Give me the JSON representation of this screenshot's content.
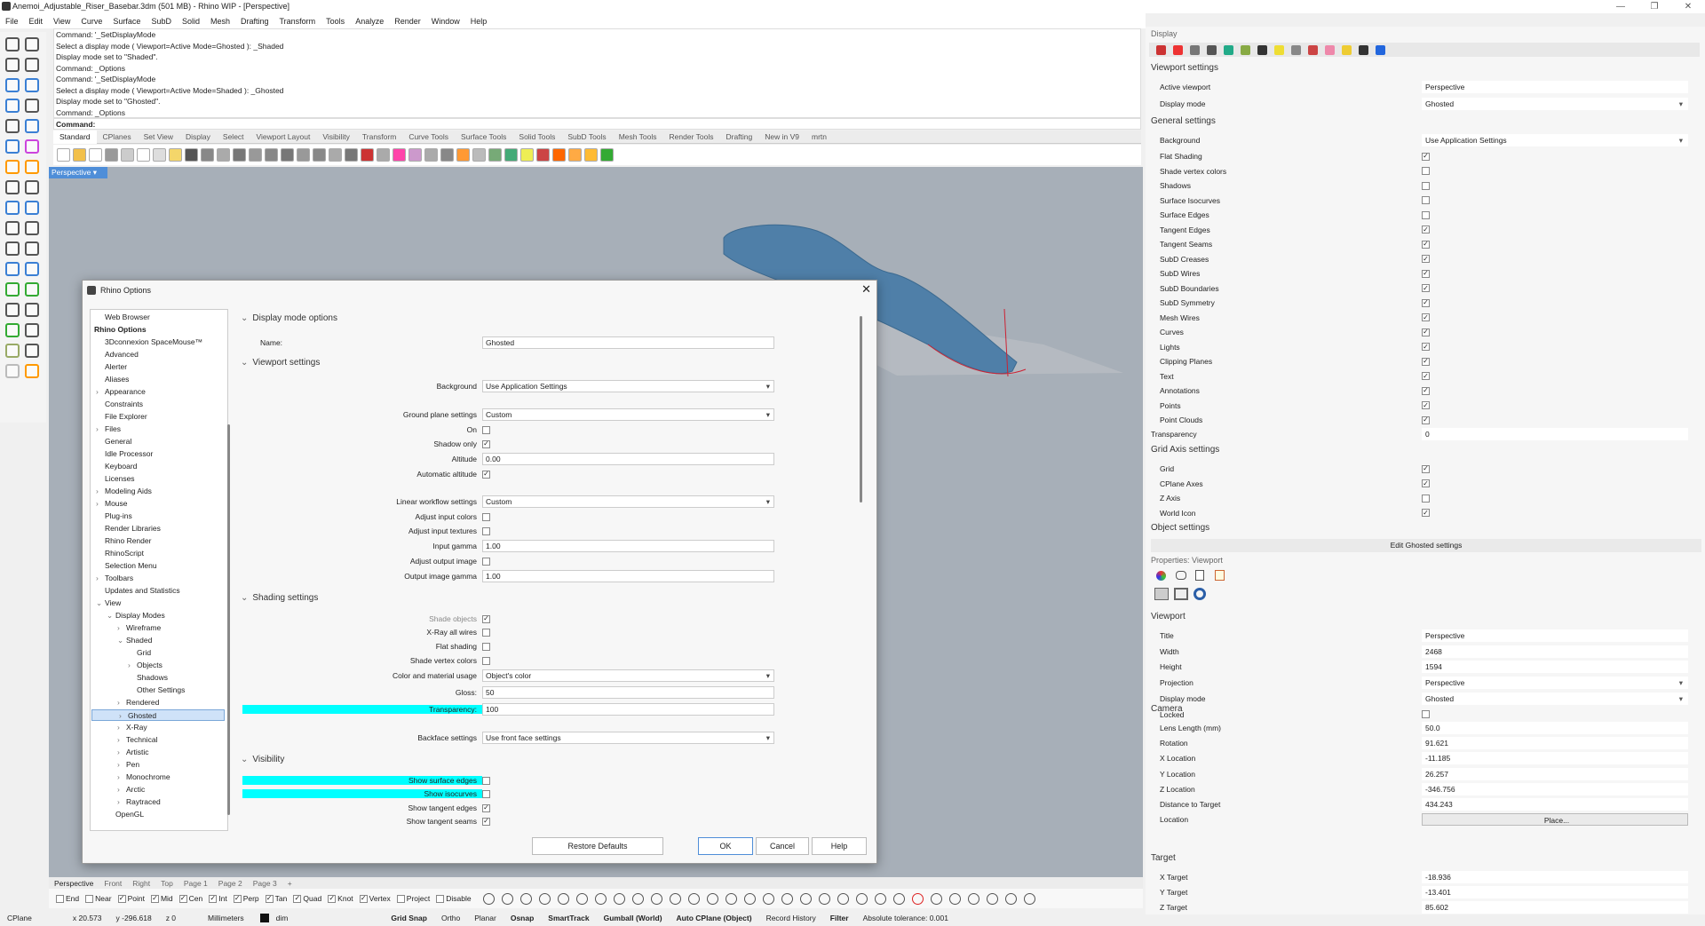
{
  "window": {
    "title": "Anemoi_Adjustable_Riser_Basebar.3dm (501 MB) - Rhino WIP - [Perspective]"
  },
  "menu": [
    "File",
    "Edit",
    "View",
    "Curve",
    "Surface",
    "SubD",
    "Solid",
    "Mesh",
    "Drafting",
    "Transform",
    "Tools",
    "Analyze",
    "Render",
    "Window",
    "Help"
  ],
  "command_history": [
    "Command: '_SetDisplayMode",
    "Select a display mode ( Viewport=Active  Mode=Ghosted ): _Shaded",
    "Display mode set to \"Shaded\".",
    "Command: _Options",
    "Command: '_SetDisplayMode",
    "Select a display mode ( Viewport=Active  Mode=Shaded ): _Ghosted",
    "Display mode set to \"Ghosted\".",
    "Command: _Options"
  ],
  "command_prompt": "Command:",
  "toolbar_tabs": [
    "Standard",
    "CPlanes",
    "Set View",
    "Display",
    "Select",
    "Viewport Layout",
    "Visibility",
    "Transform",
    "Curve Tools",
    "Surface Tools",
    "Solid Tools",
    "SubD Tools",
    "Mesh Tools",
    "Render Tools",
    "Drafting",
    "New in V9",
    "mrtn"
  ],
  "viewport_label": "Perspective",
  "viewport_tabs": [
    "Perspective",
    "Front",
    "Right",
    "Top",
    "Page 1",
    "Page 2",
    "Page 3"
  ],
  "osnaps": [
    {
      "label": "End",
      "checked": false
    },
    {
      "label": "Near",
      "checked": false
    },
    {
      "label": "Point",
      "checked": true
    },
    {
      "label": "Mid",
      "checked": true
    },
    {
      "label": "Cen",
      "checked": true
    },
    {
      "label": "Int",
      "checked": true
    },
    {
      "label": "Perp",
      "checked": true
    },
    {
      "label": "Tan",
      "checked": true
    },
    {
      "label": "Quad",
      "checked": true
    },
    {
      "label": "Knot",
      "checked": true
    },
    {
      "label": "Vertex",
      "checked": true
    },
    {
      "label": "Project",
      "checked": false
    },
    {
      "label": "Disable",
      "checked": false
    }
  ],
  "status": {
    "cplane": "CPlane",
    "x": "x 20.573",
    "y": "y -296.618",
    "z": "z 0",
    "units": "Millimeters",
    "layer": "dim",
    "items": [
      "Grid Snap",
      "Ortho",
      "Planar",
      "Osnap",
      "SmartTrack",
      "Gumball (World)",
      "Auto CPlane (Object)",
      "Record History",
      "Filter"
    ],
    "bold_items": [
      "Grid Snap",
      "Osnap",
      "SmartTrack",
      "Gumball (World)",
      "Auto CPlane (Object)",
      "Filter"
    ],
    "tolerance": "Absolute tolerance: 0.001"
  },
  "display_panel": {
    "title": "Display",
    "viewport_settings_head": "Viewport settings",
    "active_viewport_label": "Active viewport",
    "active_viewport": "Perspective",
    "display_mode_label": "Display mode",
    "display_mode": "Ghosted",
    "general_head": "General settings",
    "background_label": "Background",
    "background": "Use Application Settings",
    "checks": [
      {
        "label": "Flat Shading",
        "checked": true
      },
      {
        "label": "Shade vertex colors",
        "checked": false
      },
      {
        "label": "Shadows",
        "checked": false
      },
      {
        "label": "Surface Isocurves",
        "checked": false
      },
      {
        "label": "Surface Edges",
        "checked": false
      },
      {
        "label": "Tangent Edges",
        "checked": true
      },
      {
        "label": "Tangent Seams",
        "checked": true
      },
      {
        "label": "SubD Creases",
        "checked": true
      },
      {
        "label": "SubD Wires",
        "checked": true
      },
      {
        "label": "SubD Boundaries",
        "checked": true
      },
      {
        "label": "SubD Symmetry",
        "checked": true
      },
      {
        "label": "Mesh Wires",
        "checked": true
      },
      {
        "label": "Curves",
        "checked": true
      },
      {
        "label": "Lights",
        "checked": true
      },
      {
        "label": "Clipping Planes",
        "checked": true
      },
      {
        "label": "Text",
        "checked": true
      },
      {
        "label": "Annotations",
        "checked": true
      },
      {
        "label": "Points",
        "checked": true
      },
      {
        "label": "Point Clouds",
        "checked": true
      }
    ],
    "transparency_label": "Transparency",
    "transparency": "0",
    "grid_head": "Grid  Axis settings",
    "grid_checks": [
      {
        "label": "Grid",
        "checked": true
      },
      {
        "label": "CPlane Axes",
        "checked": true
      },
      {
        "label": "Z Axis",
        "checked": false
      },
      {
        "label": "World Icon",
        "checked": true
      }
    ],
    "object_head": "Object settings",
    "edit_button": "Edit Ghosted settings"
  },
  "properties_panel": {
    "title": "Properties: Viewport",
    "viewport_head": "Viewport",
    "viewport_rows": [
      {
        "label": "Title",
        "value": "Perspective",
        "type": "text"
      },
      {
        "label": "Width",
        "value": "2468",
        "type": "spin"
      },
      {
        "label": "Height",
        "value": "1594",
        "type": "spin"
      },
      {
        "label": "Projection",
        "value": "Perspective",
        "type": "dd"
      },
      {
        "label": "Display mode",
        "value": "Ghosted",
        "type": "dd"
      },
      {
        "label": "Locked",
        "value": "",
        "type": "check"
      }
    ],
    "camera_head": "Camera",
    "camera_rows": [
      {
        "label": "Lens Length (mm)",
        "value": "50.0",
        "type": "spin"
      },
      {
        "label": "Rotation",
        "value": "91.621",
        "type": "spin"
      },
      {
        "label": "X Location",
        "value": "-11.185",
        "type": "spin"
      },
      {
        "label": "Y Location",
        "value": "26.257",
        "type": "spin"
      },
      {
        "label": "Z Location",
        "value": "-346.756",
        "type": "spin"
      },
      {
        "label": "Distance to Target",
        "value": "434.243",
        "type": "text"
      },
      {
        "label": "Location",
        "value": "Place...",
        "type": "button"
      }
    ],
    "target_head": "Target",
    "target_rows": [
      {
        "label": "X Target",
        "value": "-18.936",
        "type": "spin"
      },
      {
        "label": "Y Target",
        "value": "-13.401",
        "type": "spin"
      },
      {
        "label": "Z Target",
        "value": "85.602",
        "type": "spin"
      }
    ]
  },
  "dialog": {
    "title": "Rhino Options",
    "tree": [
      {
        "label": "Web Browser",
        "level": 1,
        "arrow": ""
      },
      {
        "label": "Rhino Options",
        "level": 0,
        "arrow": "",
        "bold": true
      },
      {
        "label": "3Dconnexion SpaceMouse™",
        "level": 1,
        "arrow": ""
      },
      {
        "label": "Advanced",
        "level": 1,
        "arrow": ""
      },
      {
        "label": "Alerter",
        "level": 1,
        "arrow": ""
      },
      {
        "label": "Aliases",
        "level": 1,
        "arrow": ""
      },
      {
        "label": "Appearance",
        "level": 1,
        "arrow": "›"
      },
      {
        "label": "Constraints",
        "level": 1,
        "arrow": ""
      },
      {
        "label": "File Explorer",
        "level": 1,
        "arrow": ""
      },
      {
        "label": "Files",
        "level": 1,
        "arrow": "›"
      },
      {
        "label": "General",
        "level": 1,
        "arrow": ""
      },
      {
        "label": "Idle Processor",
        "level": 1,
        "arrow": ""
      },
      {
        "label": "Keyboard",
        "level": 1,
        "arrow": ""
      },
      {
        "label": "Licenses",
        "level": 1,
        "arrow": ""
      },
      {
        "label": "Modeling Aids",
        "level": 1,
        "arrow": "›"
      },
      {
        "label": "Mouse",
        "level": 1,
        "arrow": "›"
      },
      {
        "label": "Plug-ins",
        "level": 1,
        "arrow": ""
      },
      {
        "label": "Render Libraries",
        "level": 1,
        "arrow": ""
      },
      {
        "label": "Rhino Render",
        "level": 1,
        "arrow": ""
      },
      {
        "label": "RhinoScript",
        "level": 1,
        "arrow": ""
      },
      {
        "label": "Selection Menu",
        "level": 1,
        "arrow": ""
      },
      {
        "label": "Toolbars",
        "level": 1,
        "arrow": "›"
      },
      {
        "label": "Updates and Statistics",
        "level": 1,
        "arrow": ""
      },
      {
        "label": "View",
        "level": 1,
        "arrow": "⌄"
      },
      {
        "label": "Display Modes",
        "level": 2,
        "arrow": "⌄"
      },
      {
        "label": "Wireframe",
        "level": 3,
        "arrow": "›"
      },
      {
        "label": "Shaded",
        "level": 3,
        "arrow": "⌄"
      },
      {
        "label": "Grid",
        "level": 4,
        "arrow": ""
      },
      {
        "label": "Objects",
        "level": 4,
        "arrow": "›"
      },
      {
        "label": "Shadows",
        "level": 4,
        "arrow": ""
      },
      {
        "label": "Other Settings",
        "level": 4,
        "arrow": ""
      },
      {
        "label": "Rendered",
        "level": 3,
        "arrow": "›"
      },
      {
        "label": "Ghosted",
        "level": 3,
        "arrow": "›",
        "selected": true
      },
      {
        "label": "X-Ray",
        "level": 3,
        "arrow": "›"
      },
      {
        "label": "Technical",
        "level": 3,
        "arrow": "›"
      },
      {
        "label": "Artistic",
        "level": 3,
        "arrow": "›"
      },
      {
        "label": "Pen",
        "level": 3,
        "arrow": "›"
      },
      {
        "label": "Monochrome",
        "level": 3,
        "arrow": "›"
      },
      {
        "label": "Arctic",
        "level": 3,
        "arrow": "›"
      },
      {
        "label": "Raytraced",
        "level": 3,
        "arrow": "›"
      },
      {
        "label": "OpenGL",
        "level": 2,
        "arrow": ""
      }
    ],
    "sections": {
      "display_mode_options": "Display mode options",
      "viewport_settings": "Viewport settings",
      "shading_settings": "Shading settings",
      "visibility": "Visibility"
    },
    "name_label": "Name:",
    "name_value": "Ghosted",
    "rows": {
      "background": {
        "label": "Background",
        "value": "Use Application Settings"
      },
      "ground_plane": {
        "label": "Ground plane settings",
        "value": "Custom"
      },
      "on": {
        "label": "On",
        "checked": false
      },
      "shadow_only": {
        "label": "Shadow only",
        "checked": true
      },
      "altitude": {
        "label": "Altitude",
        "value": "0.00"
      },
      "auto_altitude": {
        "label": "Automatic altitude",
        "checked": true
      },
      "linear_workflow": {
        "label": "Linear workflow settings",
        "value": "Custom"
      },
      "adjust_input_colors": {
        "label": "Adjust input colors",
        "checked": false
      },
      "adjust_input_textures": {
        "label": "Adjust input textures",
        "checked": false
      },
      "input_gamma": {
        "label": "Input gamma",
        "value": "1.00"
      },
      "adjust_output_image": {
        "label": "Adjust output image",
        "checked": false
      },
      "output_gamma": {
        "label": "Output image gamma",
        "value": "1.00"
      },
      "shade_objects": {
        "label": "Shade objects",
        "checked": true
      },
      "xray_all_wires": {
        "label": "X-Ray all wires",
        "checked": false
      },
      "flat_shading": {
        "label": "Flat shading",
        "checked": false
      },
      "shade_vertex_colors": {
        "label": "Shade vertex colors",
        "checked": false
      },
      "color_material": {
        "label": "Color and material usage",
        "value": "Object's color"
      },
      "gloss": {
        "label": "Gloss:",
        "value": "50"
      },
      "transparency": {
        "label": "Transparency:",
        "value": "100"
      },
      "backface": {
        "label": "Backface settings",
        "value": "Use front face settings"
      },
      "show_surface_edges": {
        "label": "Show surface edges",
        "checked": false
      },
      "show_isocurves": {
        "label": "Show isocurves",
        "checked": false
      },
      "show_tangent_edges": {
        "label": "Show tangent edges",
        "checked": true
      },
      "show_tangent_seams": {
        "label": "Show tangent seams",
        "checked": true
      }
    },
    "buttons": {
      "restore": "Restore Defaults",
      "ok": "OK",
      "cancel": "Cancel",
      "help": "Help"
    }
  },
  "colors": {
    "highlight": "#00ffff",
    "accent": "#4f8ed8",
    "model": "#4f7fa8",
    "viewport_bg": "#a7afb8"
  }
}
